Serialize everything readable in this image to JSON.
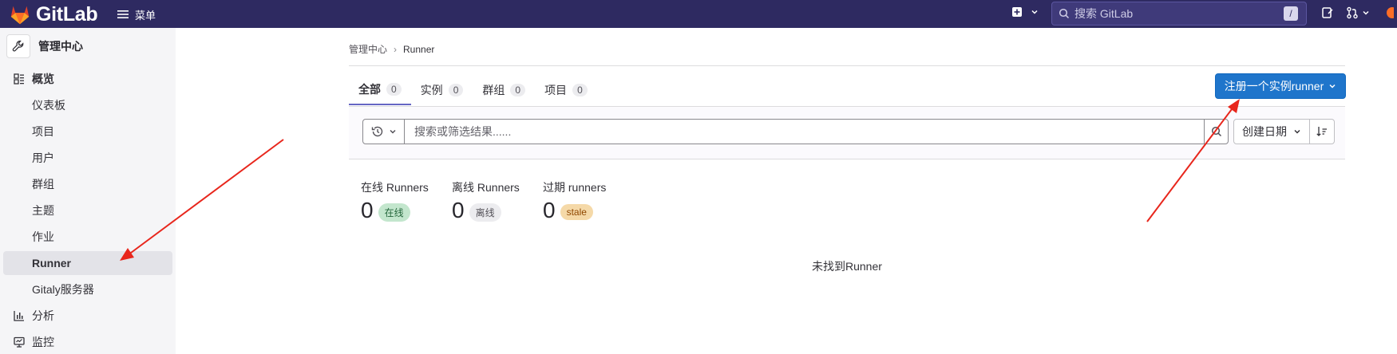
{
  "topbar": {
    "brand": "GitLab",
    "menu_label": "菜单",
    "search_placeholder": "搜索 GitLab",
    "search_shortcut": "/"
  },
  "sidebar": {
    "header": "管理中心",
    "items": [
      {
        "label": "概览",
        "icon": "overview-icon"
      },
      {
        "label": "仪表板"
      },
      {
        "label": "项目"
      },
      {
        "label": "用户"
      },
      {
        "label": "群组"
      },
      {
        "label": "主题"
      },
      {
        "label": "作业"
      },
      {
        "label": "Runner",
        "active": true
      },
      {
        "label": "Gitaly服务器"
      },
      {
        "label": "分析",
        "icon": "chart-icon"
      },
      {
        "label": "监控",
        "icon": "monitor-icon"
      }
    ]
  },
  "breadcrumb": {
    "parent": "管理中心",
    "current": "Runner"
  },
  "tabs": [
    {
      "label": "全部",
      "count": "0",
      "active": true
    },
    {
      "label": "实例",
      "count": "0"
    },
    {
      "label": "群组",
      "count": "0"
    },
    {
      "label": "项目",
      "count": "0"
    }
  ],
  "register_button": "注册一个实例runner",
  "filter": {
    "placeholder": "搜索或筛选结果......",
    "sort_label": "创建日期"
  },
  "stats": [
    {
      "label": "在线 Runners",
      "value": "0",
      "badge": "在线",
      "color": "#c3e6cd"
    },
    {
      "label": "离线 Runners",
      "value": "0",
      "badge": "离线",
      "color": "#ececef"
    },
    {
      "label": "过期 runners",
      "value": "0",
      "badge": "stale",
      "color": "#f5d9a8"
    }
  ],
  "empty_message": "未找到Runner",
  "colors": {
    "topbar": "#2e2a61",
    "primary": "#1f75cb",
    "annotation_arrow": "#e8261c"
  }
}
